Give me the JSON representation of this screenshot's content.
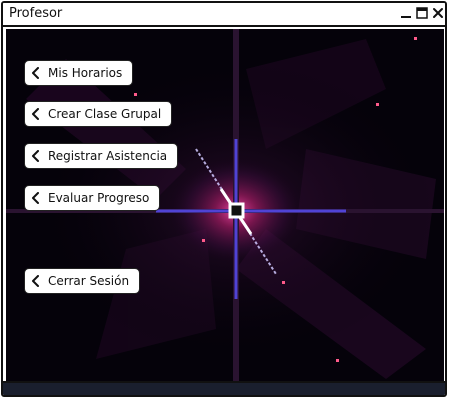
{
  "window": {
    "title": "Profesor"
  },
  "menu": {
    "items": [
      {
        "label": "Mis Horarios",
        "icon": "chevron-left-icon"
      },
      {
        "label": "Crear Clase Grupal",
        "icon": "chevron-left-icon"
      },
      {
        "label": "Registrar Asistencia",
        "icon": "chevron-left-icon"
      },
      {
        "label": "Evaluar Progreso",
        "icon": "chevron-left-icon"
      },
      {
        "label": "Cerrar Sesión",
        "icon": "chevron-left-icon"
      }
    ]
  },
  "colors": {
    "background": "#05020a",
    "nebula": "#3a0f3a",
    "star_core": "#ffffff",
    "star_glow": "#ff3fa0",
    "spike": "#5a4fff"
  }
}
